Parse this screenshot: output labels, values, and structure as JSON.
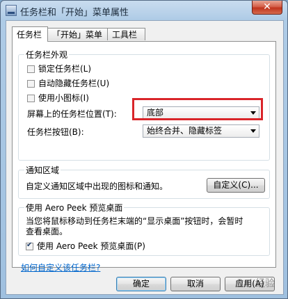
{
  "window": {
    "title": "任务栏和「开始」菜单属性",
    "close_label": "✕"
  },
  "tabs": [
    {
      "label": "任务栏",
      "active": true
    },
    {
      "label": "「开始」菜单",
      "active": false
    },
    {
      "label": "工具栏",
      "active": false
    }
  ],
  "appearance": {
    "title": "任务栏外观",
    "lock_label": "锁定任务栏(L)",
    "lock_checked": false,
    "autohide_label": "自动隐藏任务栏(U)",
    "autohide_checked": false,
    "small_icons_label": "使用小图标(I)",
    "small_icons_checked": false,
    "position_label": "屏幕上的任务栏位置(T):",
    "position_value": "底部",
    "buttons_label": "任务栏按钮(B):",
    "buttons_value": "始终合并、隐藏标签"
  },
  "notification": {
    "title": "通知区域",
    "description": "自定义通知区域中出现的图标和通知。",
    "customize_label": "自定义(C)..."
  },
  "aero_peek": {
    "title": "使用 Aero Peek 预览桌面",
    "description_line1": "当您将鼠标移动到任务栏末端的“显示桌面”按钮时，会暂时",
    "description_line2": "查看桌面。",
    "checkbox_label": "使用 Aero Peek 预览桌面(P)",
    "checkbox_checked": true
  },
  "help_link": "如何自定义该任务栏?",
  "footer": {
    "ok_label": "确定",
    "cancel_label": "取消",
    "apply_label": "应用(A)"
  },
  "watermark": "Bai 经验",
  "colors": {
    "highlight": "#d9252a",
    "link": "#0066cc",
    "close": "#c0341d"
  }
}
